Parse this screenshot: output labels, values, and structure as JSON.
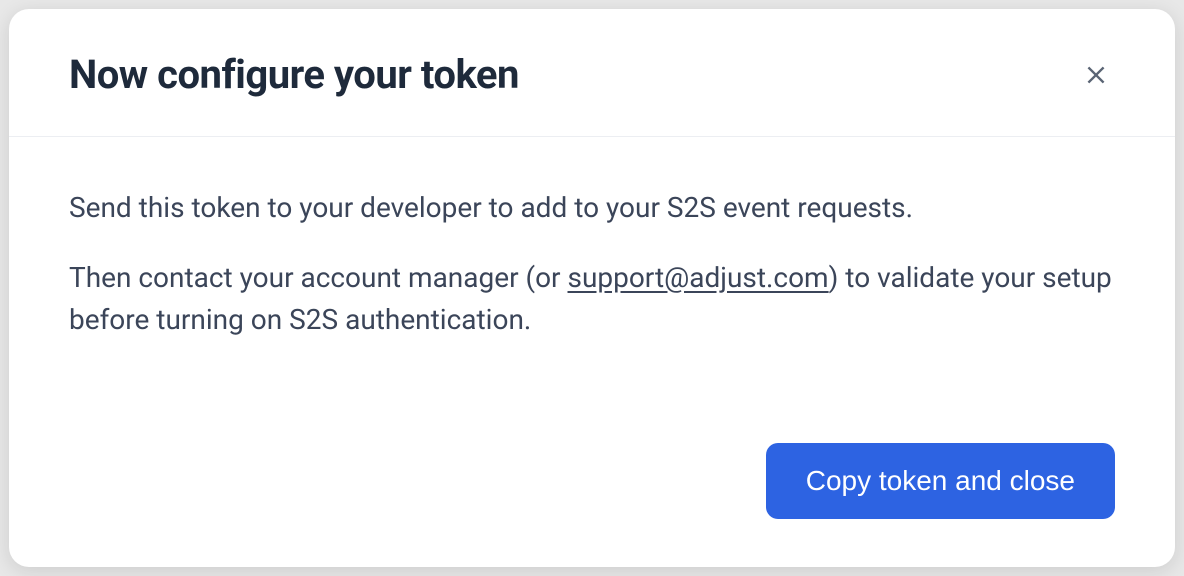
{
  "modal": {
    "title": "Now configure your token",
    "body": {
      "line1": "Send this token to your developer to add to your S2S event requests.",
      "line2_pre": "Then contact your account manager (or ",
      "email": "support@adjust.com",
      "line2_post": ") to validate your setup before turning on S2S authentication."
    },
    "footer": {
      "primary_label": "Copy token and close"
    }
  }
}
